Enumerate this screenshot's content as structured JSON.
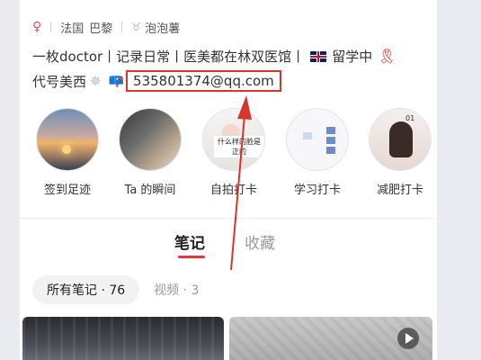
{
  "profile": {
    "country": "法国",
    "city": "巴黎",
    "badge": "泡泡薯",
    "bio_line1": "一枚doctor丨记录日常丨医美都在林双医馆丨",
    "bio_line1_suffix": "留学中",
    "bio_line2": "代号美西",
    "email": "535801374@qq.com"
  },
  "highlights": [
    {
      "label": "签到足迹"
    },
    {
      "label": "Ta 的瞬间"
    },
    {
      "label": "自拍打卡",
      "caption": "什么样的脸是正的"
    },
    {
      "label": "学习打卡"
    },
    {
      "label": "减肥打卡",
      "badge": "01"
    }
  ],
  "tabs": [
    {
      "label": "笔记",
      "active": true
    },
    {
      "label": "收藏",
      "active": false
    }
  ],
  "filters": {
    "all_notes": "所有笔记 · 76",
    "video": "视频 · 3"
  },
  "colors": {
    "accent": "#e5363b",
    "highlight_box": "#d9352f"
  },
  "icons": {
    "gender": "female-symbol",
    "badge": "medal",
    "flag": "uk-flag",
    "ribbon": "red-ribbon",
    "web": "spider-web",
    "mailbox": "mailbox",
    "play": "play"
  }
}
